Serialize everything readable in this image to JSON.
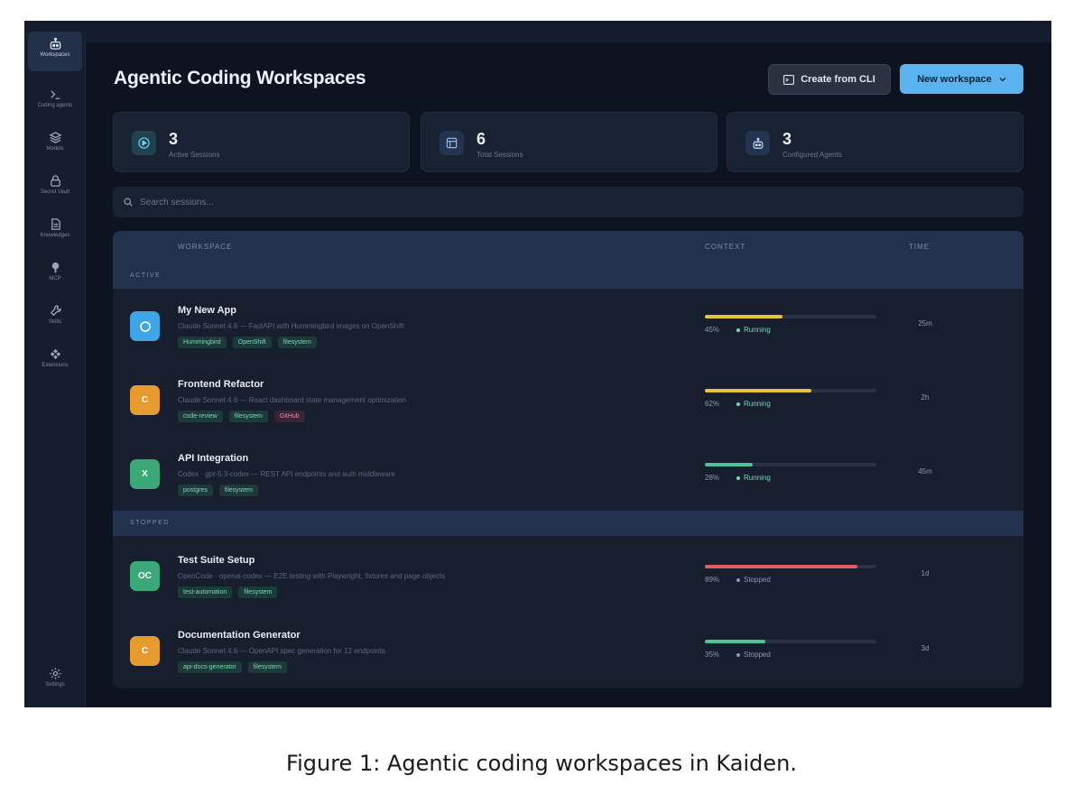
{
  "sidebar": {
    "items": [
      {
        "label": "Workspaces",
        "icon": "robot-icon",
        "active": true
      },
      {
        "label": "Coding agents",
        "icon": "terminal-icon"
      },
      {
        "label": "Models",
        "icon": "layers-icon"
      },
      {
        "label": "Secret Vault",
        "icon": "lock-icon"
      },
      {
        "label": "Knowledges",
        "icon": "document-icon"
      },
      {
        "label": "MCP",
        "icon": "plug-icon"
      },
      {
        "label": "Skills",
        "icon": "wrench-icon"
      },
      {
        "label": "Extensions",
        "icon": "puzzle-icon"
      }
    ],
    "settings": {
      "label": "Settings",
      "icon": "gear-icon"
    }
  },
  "header": {
    "title": "Agentic Coding Workspaces",
    "cli_button": "Create from CLI",
    "new_button": "New workspace"
  },
  "stats": [
    {
      "value": "3",
      "label": "Active Sessions",
      "icon": "play-circle-icon"
    },
    {
      "value": "6",
      "label": "Total Sessions",
      "icon": "window-icon"
    },
    {
      "value": "3",
      "label": "Configured Agents",
      "icon": "robot-icon"
    }
  ],
  "search": {
    "placeholder": "Search sessions..."
  },
  "table": {
    "columns": {
      "workspace": "WORKSPACE",
      "context": "CONTEXT",
      "time": "TIME"
    },
    "groups": {
      "active": "ACTIVE",
      "stopped": "STOPPED"
    },
    "rows": [
      {
        "name": "My New App",
        "desc": "Claude Sonnet 4.6 — FastAPI with Hummingbird images on OpenShift",
        "tags": [
          "Hummingbird",
          "OpenShift",
          "filesystem"
        ],
        "avatar": "",
        "avatar_color": "#3ea6e6",
        "progress": 0.45,
        "pct": "45%",
        "status": "Running",
        "bar_color": "#e8c23c",
        "time": "25m"
      },
      {
        "name": "Frontend Refactor",
        "desc": "Claude Sonnet 4.6 — React dashboard state management optimization",
        "tags": [
          "code-review",
          "filesystem",
          "GitHub"
        ],
        "avatar": "C",
        "avatar_color": "#e79a2e",
        "progress": 0.62,
        "pct": "62%",
        "status": "Running",
        "bar_color": "#e8c23c",
        "time": "2h"
      },
      {
        "name": "API Integration",
        "desc": "Codex · gpt-5.3-codex — REST API endpoints and auth middleware",
        "tags": [
          "postgres",
          "filesystem"
        ],
        "avatar": "X",
        "avatar_color": "#3aa877",
        "progress": 0.28,
        "pct": "28%",
        "status": "Running",
        "bar_color": "#4cc497",
        "time": "45m"
      },
      {
        "name": "Test Suite Setup",
        "desc": "OpenCode · openai-codex — E2E testing with Playwright, fixtures and page objects",
        "tags": [
          "test-automation",
          "filesystem"
        ],
        "avatar": "OC",
        "avatar_color": "#3aa877",
        "progress": 0.89,
        "pct": "89%",
        "status": "Stopped",
        "bar_color": "#e05d64",
        "time": "1d"
      },
      {
        "name": "Documentation Generator",
        "desc": "Claude Sonnet 4.6 — OpenAPI spec generation for 12 endpoints",
        "tags": [
          "api-docs-generator",
          "filesystem"
        ],
        "avatar": "C",
        "avatar_color": "#e79a2e",
        "progress": 0.35,
        "pct": "35%",
        "status": "Stopped",
        "bar_color": "#4cc497",
        "time": "3d"
      }
    ]
  },
  "caption": "Figure 1: Agentic coding workspaces in Kaiden."
}
